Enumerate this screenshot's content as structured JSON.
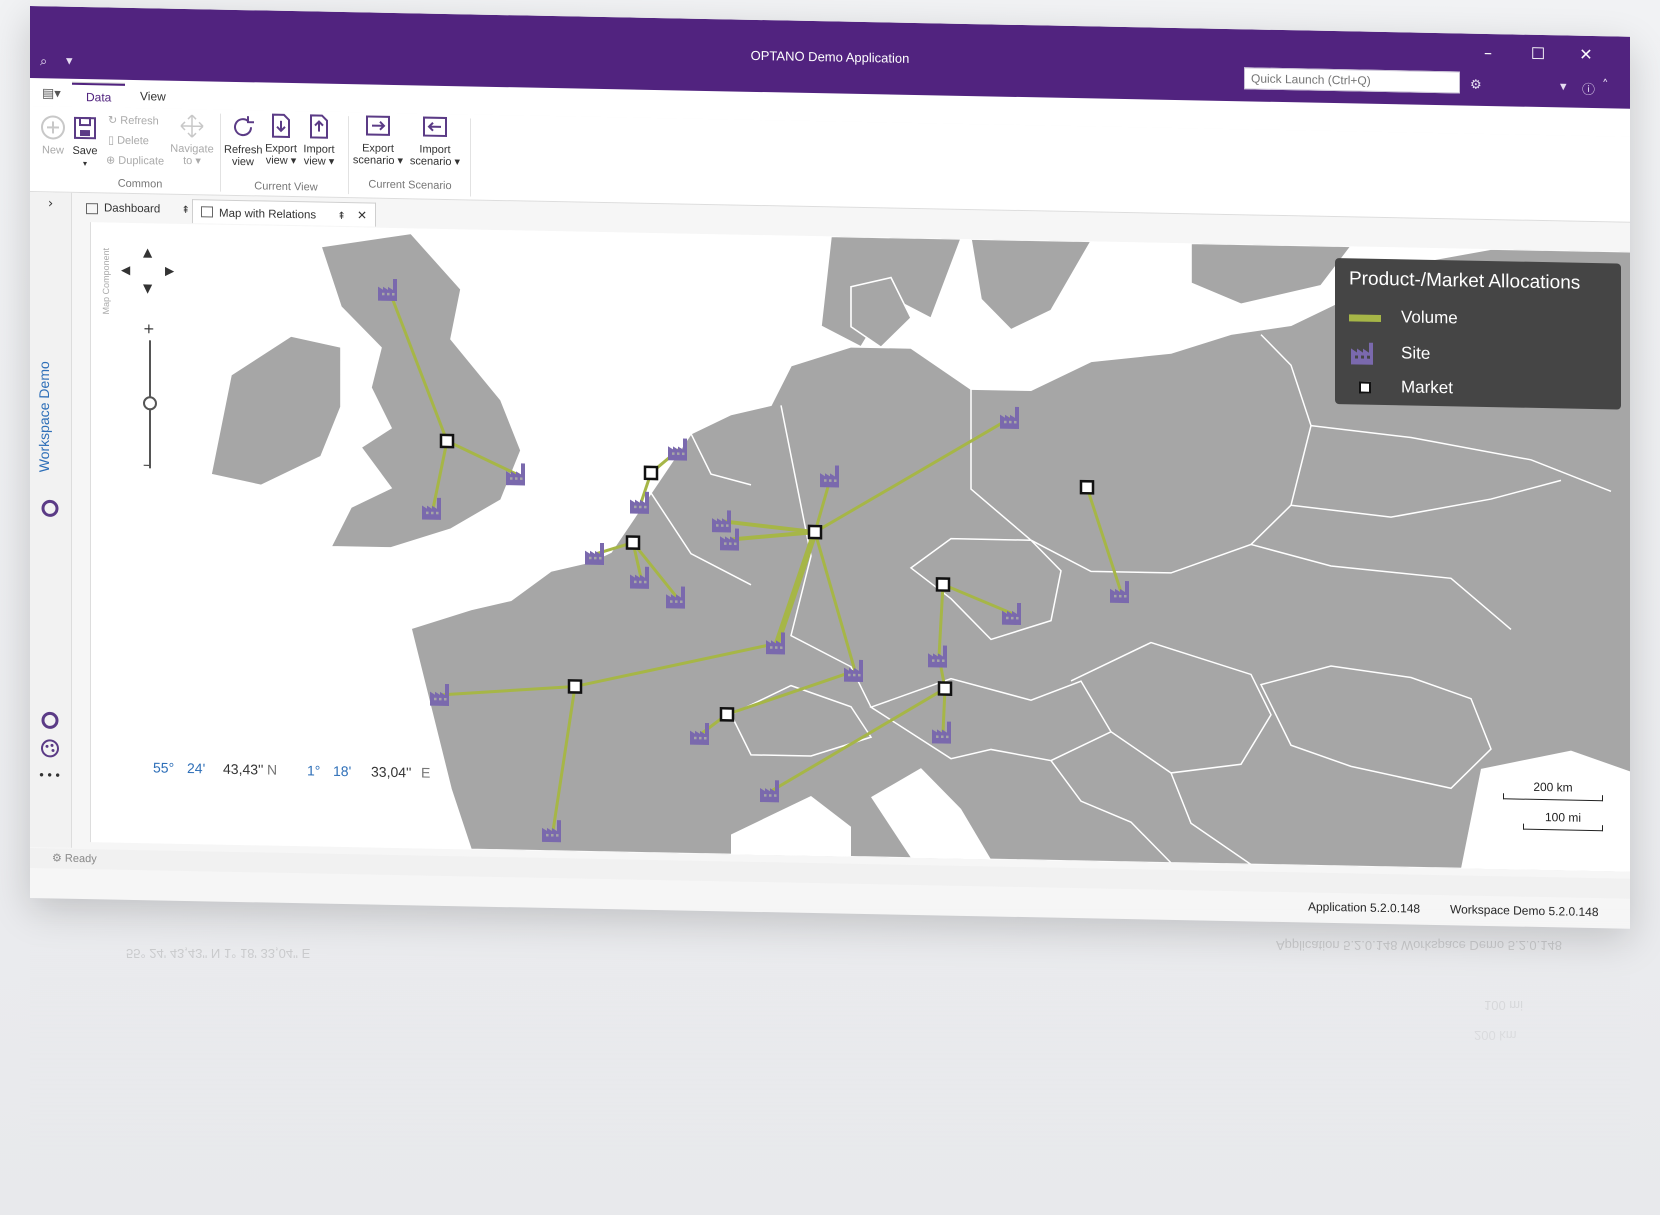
{
  "app": {
    "title": "OPTANO Demo Application",
    "quick_launch_placeholder": "Quick Launch (Ctrl+Q)"
  },
  "ribbon": {
    "tabs": [
      {
        "label": "Data",
        "active": true
      },
      {
        "label": "View",
        "active": false
      }
    ],
    "buttons": {
      "new": "New",
      "save": "Save",
      "refresh": "Refresh",
      "delete": "Delete",
      "duplicate": "Duplicate",
      "navigate_l1": "Navigate",
      "navigate_l2": "to",
      "refresh_view_l1": "Refresh",
      "refresh_view_l2": "view",
      "export_view_l1": "Export",
      "export_view_l2": "view",
      "import_view_l1": "Import",
      "import_view_l2": "view",
      "export_scenario_l1": "Export",
      "export_scenario_l2": "scenario",
      "import_scenario_l1": "Import",
      "import_scenario_l2": "scenario"
    },
    "groups": {
      "common": "Common",
      "current_view": "Current View",
      "current_scenario": "Current Scenario"
    }
  },
  "doc_tabs": [
    {
      "label": "Dashboard",
      "active": false
    },
    {
      "label": "Map with Relations",
      "active": true
    }
  ],
  "sidebar": {
    "workspace_label": "Workspace Demo",
    "more": "•••"
  },
  "map": {
    "component_label": "Map Component",
    "legend": {
      "title": "Product-/Market Allocations",
      "items": {
        "volume": "Volume",
        "site": "Site",
        "market": "Market"
      }
    },
    "colors": {
      "land": "#a6a6a6",
      "sea": "#ffffff",
      "relation": "#a6b647",
      "site": "#7a69ad",
      "legend_bg": "#454545"
    },
    "zoom": {
      "plus": "+",
      "minus": "–"
    },
    "coords": {
      "lat_deg": "55°",
      "lat_min": "24'",
      "lat_sec": "43,43''",
      "lat_hem": "N",
      "lon_deg": "1°",
      "lon_min": "18'",
      "lon_sec": "33,04''",
      "lon_hem": "E"
    },
    "scale": {
      "km": "200 km",
      "mi": "100 mi"
    }
  },
  "status": {
    "ready": "Ready",
    "app_version": "Application 5.2.0.148",
    "workspace_version": "Workspace Demo 5.2.0.148"
  },
  "reflection": {
    "coords": "55°   24'   43,43'' N      1°   18'   33,04'' E",
    "versions": "Application 5.2.0.148   Workspace Demo 5.2.0.148",
    "km": "200 km",
    "mi": "100 mi"
  }
}
